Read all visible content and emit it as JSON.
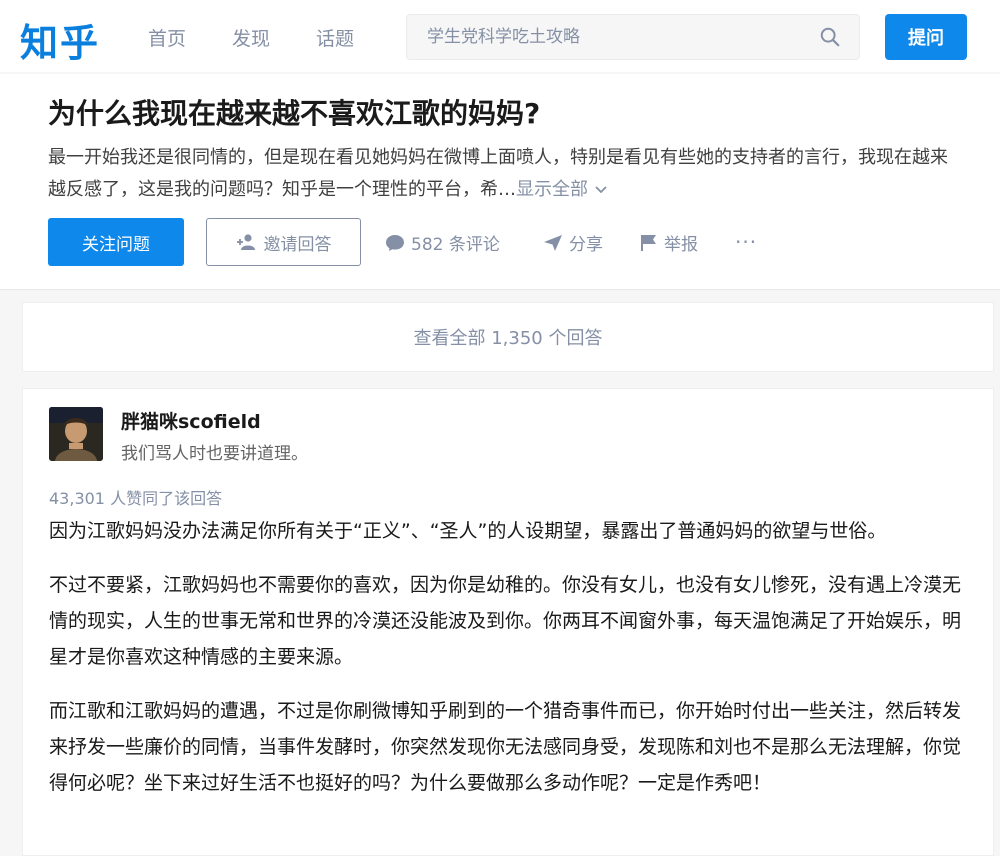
{
  "header": {
    "logo": "知乎",
    "nav": [
      "首页",
      "发现",
      "话题"
    ],
    "search_placeholder": "学生党科学吃土攻略",
    "ask_label": "提问"
  },
  "question": {
    "title": "为什么我现在越来越不喜欢江歌的妈妈?",
    "detail": "最一开始我还是很同情的，但是现在看见她妈妈在微博上面喷人，特别是看见有些她的支持者的言行，我现在越来越反感了，这是我的问题吗？知乎是一个理性的平台，希…",
    "show_all": "显示全部",
    "follow_label": "关注问题",
    "invite_label": "邀请回答",
    "comments_label": "582 条评论",
    "share_label": "分享",
    "report_label": "举报",
    "more_label": "···"
  },
  "view_all": "查看全部 1,350 个回答",
  "answer": {
    "author": "胖猫咪scofield",
    "headline": "我们骂人时也要讲道理。",
    "votes": "43,301 人赞同了该回答",
    "paragraphs": [
      "因为江歌妈妈没办法满足你所有关于“正义”、“圣人”的人设期望，暴露出了普通妈妈的欲望与世俗。",
      "不过不要紧，江歌妈妈也不需要你的喜欢，因为你是幼稚的。你没有女儿，也没有女儿惨死，没有遇上冷漠无情的现实，人生的世事无常和世界的冷漠还没能波及到你。你两耳不闻窗外事，每天温饱满足了开始娱乐，明星才是你喜欢这种情感的主要来源。",
      "而江歌和江歌妈妈的遭遇，不过是你刷微博知乎刷到的一个猎奇事件而已，你开始时付出一些关注，然后转发来抒发一些廉价的同情，当事件发酵时，你突然发现你无法感同身受，发现陈和刘也不是那么无法理解，你觉得何必呢？坐下来过好生活不也挺好的吗？为什么要做那么多动作呢？一定是作秀吧！"
    ]
  },
  "colors": {
    "brand": "#0f88eb",
    "muted": "#8590a6"
  }
}
